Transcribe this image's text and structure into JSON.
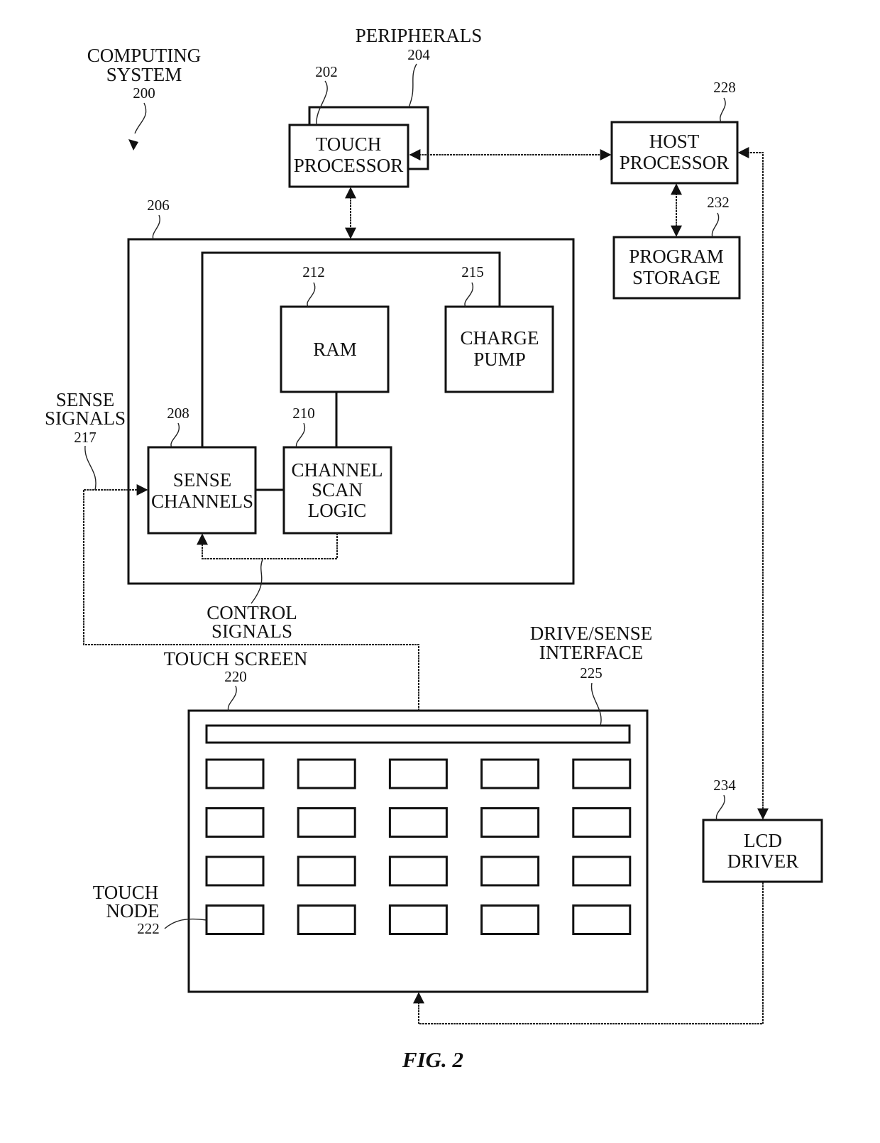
{
  "figure": {
    "title": "FIG. 2",
    "type": "block-diagram"
  },
  "system": {
    "label": [
      "COMPUTING",
      "SYSTEM"
    ],
    "ref": "200"
  },
  "blocks": {
    "peripherals": {
      "label": [
        "PERIPHERALS"
      ],
      "ref": "204"
    },
    "touch_processor": {
      "label": [
        "TOUCH",
        "PROCESSOR"
      ],
      "ref": "202"
    },
    "host_processor": {
      "label": [
        "HOST",
        "PROCESSOR"
      ],
      "ref": "228"
    },
    "program_storage": {
      "label": [
        "PROGRAM",
        "STORAGE"
      ],
      "ref": "232"
    },
    "touch_controller": {
      "ref": "206"
    },
    "ram": {
      "label": [
        "RAM"
      ],
      "ref": "212"
    },
    "charge_pump": {
      "label": [
        "CHARGE",
        "PUMP"
      ],
      "ref": "215"
    },
    "sense_channels": {
      "label": [
        "SENSE",
        "CHANNELS"
      ],
      "ref": "208"
    },
    "channel_scan_logic": {
      "label": [
        "CHANNEL",
        "SCAN",
        "LOGIC"
      ],
      "ref": "210"
    },
    "lcd_driver": {
      "label": [
        "LCD",
        "DRIVER"
      ],
      "ref": "234"
    },
    "touch_screen": {
      "label": [
        "TOUCH SCREEN"
      ],
      "ref": "220"
    },
    "drive_sense_interface": {
      "label": [
        "DRIVE/SENSE",
        "INTERFACE"
      ],
      "ref": "225"
    },
    "touch_node": {
      "label": [
        "TOUCH",
        "NODE"
      ],
      "ref": "222"
    }
  },
  "signals": {
    "sense_signals": {
      "label": [
        "SENSE",
        "SIGNALS"
      ],
      "ref": "217"
    },
    "control_signals": {
      "label": [
        "CONTROL",
        "SIGNALS"
      ]
    }
  },
  "touch_node_grid": {
    "rows": 4,
    "columns": 5
  }
}
